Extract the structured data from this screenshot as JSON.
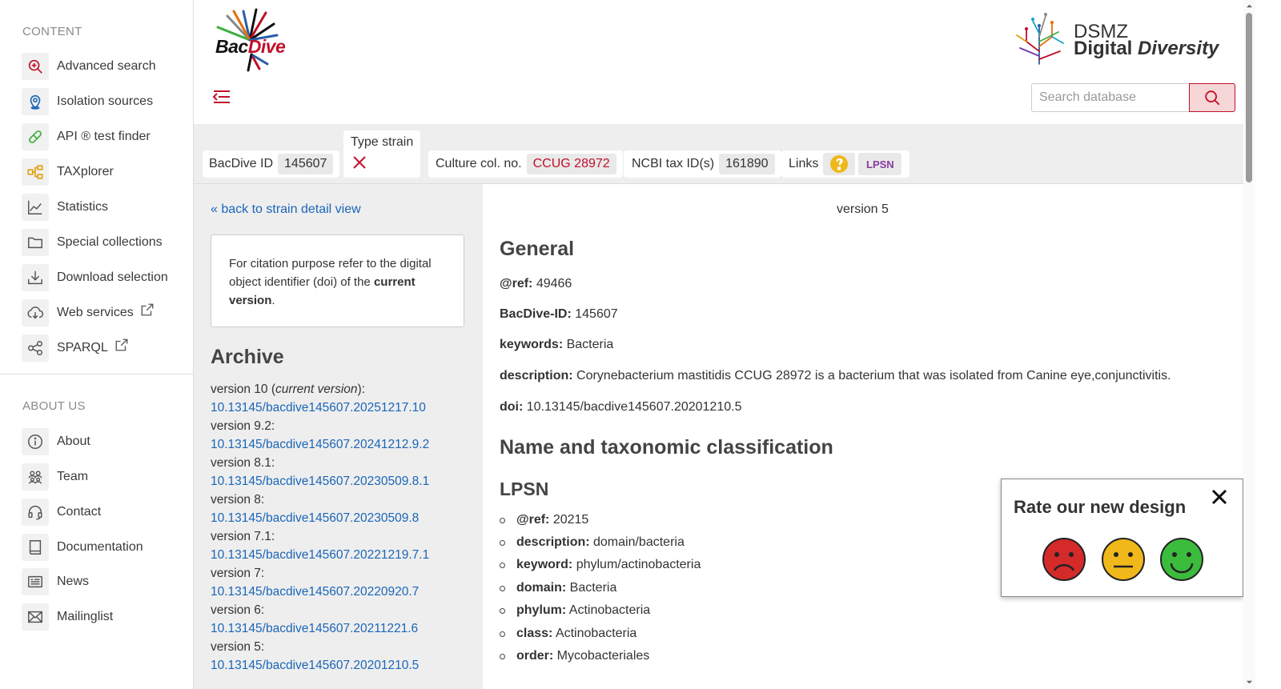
{
  "sidebar": {
    "content_heading": "CONTENT",
    "content_items": [
      {
        "label": "Advanced search",
        "icon": "zoom-plus-icon"
      },
      {
        "label": "Isolation sources",
        "icon": "location-pin-icon"
      },
      {
        "label": "API ® test finder",
        "icon": "pill-icon"
      },
      {
        "label": "TAXplorer",
        "icon": "hierarchy-icon"
      },
      {
        "label": "Statistics",
        "icon": "line-chart-icon"
      },
      {
        "label": "Special collections",
        "icon": "folder-icon"
      },
      {
        "label": "Download selection",
        "icon": "download-icon"
      },
      {
        "label": "Web services",
        "icon": "cloud-download-icon"
      },
      {
        "label": "SPARQL",
        "icon": "share-nodes-icon"
      }
    ],
    "about_heading": "ABOUT US",
    "about_items": [
      {
        "label": "About",
        "icon": "info-icon"
      },
      {
        "label": "Team",
        "icon": "team-icon"
      },
      {
        "label": "Contact",
        "icon": "headset-icon"
      },
      {
        "label": "Documentation",
        "icon": "book-icon"
      },
      {
        "label": "News",
        "icon": "newspaper-icon"
      },
      {
        "label": "Mailinglist",
        "icon": "mail-icon"
      }
    ]
  },
  "header": {
    "logo_text_black": "Bac",
    "logo_text_red": "Dive",
    "dsmz_line1": "DSMZ",
    "dsmz_line2a": "Digital ",
    "dsmz_line2b": "Diversity",
    "search_placeholder": "Search database"
  },
  "info_bar": {
    "bacdive_label": "BacDive ID",
    "bacdive_value": "145607",
    "type_strain_label": "Type strain",
    "culture_label": "Culture col. no.",
    "culture_value": "CCUG 28972",
    "ncbi_label": "NCBI tax ID(s)",
    "ncbi_value": "161890",
    "links_label": "Links",
    "lpsn_label": "LPSN"
  },
  "left": {
    "back_link": "« back to strain detail view",
    "cite_text_1": "For citation purpose refer to the digital object identifier (doi) of the ",
    "cite_bold": "current version",
    "cite_text_2": ".",
    "archive_title": "Archive",
    "archive": [
      {
        "version": "version 10 (",
        "current": "current version",
        "suffix": "):",
        "doi": "10.13145/bacdive145607.20251217.10"
      },
      {
        "version": "version 9.2:",
        "current": "",
        "suffix": "",
        "doi": "10.13145/bacdive145607.20241212.9.2"
      },
      {
        "version": "version 8.1:",
        "current": "",
        "suffix": "",
        "doi": "10.13145/bacdive145607.20230509.8.1"
      },
      {
        "version": "version 8:",
        "current": "",
        "suffix": "",
        "doi": "10.13145/bacdive145607.20230509.8"
      },
      {
        "version": "version 7.1:",
        "current": "",
        "suffix": "",
        "doi": "10.13145/bacdive145607.20221219.7.1"
      },
      {
        "version": "version 7:",
        "current": "",
        "suffix": "",
        "doi": "10.13145/bacdive145607.20220920.7"
      },
      {
        "version": "version 6:",
        "current": "",
        "suffix": "",
        "doi": "10.13145/bacdive145607.20211221.6"
      },
      {
        "version": "version 5:",
        "current": "",
        "suffix": "",
        "doi": "10.13145/bacdive145607.20201210.5"
      }
    ]
  },
  "main": {
    "version_label": "version 5",
    "general_title": "General",
    "general_fields": [
      {
        "key": "@ref:",
        "value": " 49466"
      },
      {
        "key": "BacDive-ID:",
        "value": " 145607"
      },
      {
        "key": "keywords:",
        "value": " Bacteria"
      },
      {
        "key": "description:",
        "value": " Corynebacterium mastitidis CCUG 28972 is a bacterium that was isolated from Canine eye,conjunctivitis."
      },
      {
        "key": "doi:",
        "value": " 10.13145/bacdive145607.20201210.5"
      }
    ],
    "taxonomy_title": "Name and taxonomic classification",
    "lpsn_title": "LPSN",
    "lpsn_fields": [
      {
        "key": "@ref:",
        "value": " 20215"
      },
      {
        "key": "description:",
        "value": " domain/bacteria"
      },
      {
        "key": "keyword:",
        "value": " phylum/actinobacteria"
      },
      {
        "key": "domain:",
        "value": " Bacteria"
      },
      {
        "key": "phylum:",
        "value": " Actinobacteria"
      },
      {
        "key": "class:",
        "value": " Actinobacteria"
      },
      {
        "key": "order:",
        "value": " Mycobacteriales"
      }
    ]
  },
  "rating": {
    "title": "Rate our new design"
  },
  "colors": {
    "accent_red": "#c0102a",
    "link_blue": "#1a66b8",
    "sad": "#d42a2a",
    "neutral": "#f0b81a",
    "happy": "#3cbc3c"
  }
}
